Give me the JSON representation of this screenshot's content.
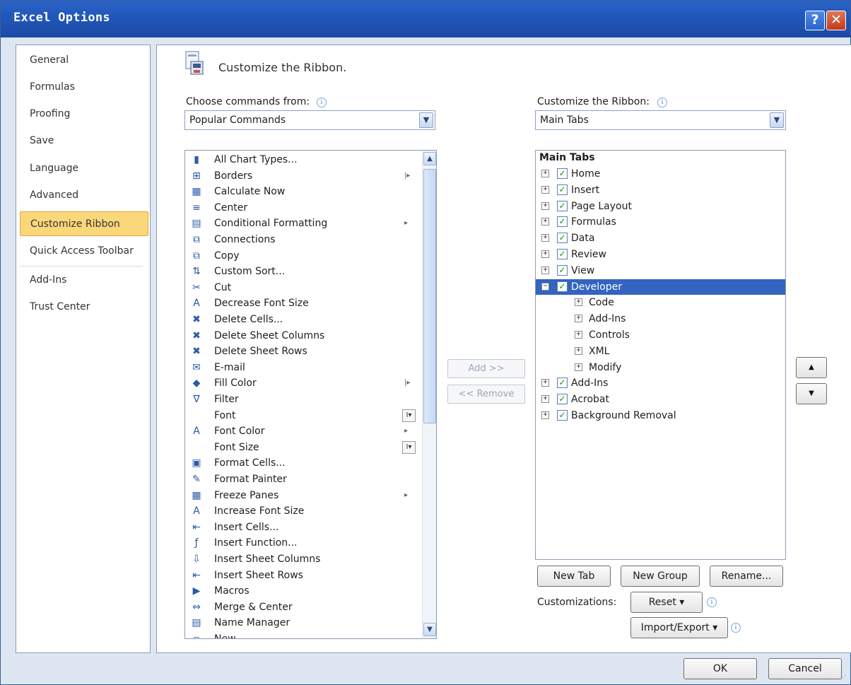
{
  "window": {
    "title": "Excel Options",
    "help": "?",
    "close": "✕"
  },
  "nav": {
    "items": [
      {
        "label": "General"
      },
      {
        "label": "Formulas"
      },
      {
        "label": "Proofing"
      },
      {
        "label": "Save"
      },
      {
        "label": "Language"
      },
      {
        "label": "Advanced"
      },
      {
        "label": "Customize Ribbon"
      },
      {
        "label": "Quick Access Toolbar"
      },
      {
        "label": "Add-Ins"
      },
      {
        "label": "Trust Center"
      }
    ],
    "selected": "Customize Ribbon"
  },
  "header": {
    "title": "Customize the Ribbon."
  },
  "left": {
    "label": "Choose commands from:",
    "combo_value": "Popular Commands",
    "commands": [
      {
        "label": "All Chart Types...",
        "icon": "chart-icon",
        "glyph": "▮"
      },
      {
        "label": "Borders",
        "icon": "borders-icon",
        "glyph": "⊞",
        "submenu": "|▸"
      },
      {
        "label": "Calculate Now",
        "icon": "calculator-icon",
        "glyph": "▦"
      },
      {
        "label": "Center",
        "icon": "align-center-icon",
        "glyph": "≡"
      },
      {
        "label": "Conditional Formatting",
        "icon": "conditional-formatting-icon",
        "glyph": "▤",
        "submenu": "▸"
      },
      {
        "label": "Connections",
        "icon": "connections-icon",
        "glyph": "⧉"
      },
      {
        "label": "Copy",
        "icon": "copy-icon",
        "glyph": "⧉"
      },
      {
        "label": "Custom Sort...",
        "icon": "sort-icon",
        "glyph": "⇅"
      },
      {
        "label": "Cut",
        "icon": "scissors-icon",
        "glyph": "✂"
      },
      {
        "label": "Decrease Font Size",
        "icon": "decrease-font-icon",
        "glyph": "A"
      },
      {
        "label": "Delete Cells...",
        "icon": "delete-cells-icon",
        "glyph": "✖"
      },
      {
        "label": "Delete Sheet Columns",
        "icon": "delete-columns-icon",
        "glyph": "✖"
      },
      {
        "label": "Delete Sheet Rows",
        "icon": "delete-rows-icon",
        "glyph": "✖"
      },
      {
        "label": "E-mail",
        "icon": "email-icon",
        "glyph": "✉"
      },
      {
        "label": "Fill Color",
        "icon": "fill-color-icon",
        "glyph": "◆",
        "submenu": "|▸"
      },
      {
        "label": "Filter",
        "icon": "filter-icon",
        "glyph": "∇"
      },
      {
        "label": "Font",
        "icon": "",
        "glyph": "",
        "spin": "I▾"
      },
      {
        "label": "Font Color",
        "icon": "font-color-icon",
        "glyph": "A",
        "submenu": "▸"
      },
      {
        "label": "Font Size",
        "icon": "",
        "glyph": "",
        "spin": "I▾"
      },
      {
        "label": "Format Cells...",
        "icon": "format-cells-icon",
        "glyph": "▣"
      },
      {
        "label": "Format Painter",
        "icon": "format-painter-icon",
        "glyph": "✎"
      },
      {
        "label": "Freeze Panes",
        "icon": "freeze-panes-icon",
        "glyph": "▦",
        "submenu": "▸"
      },
      {
        "label": "Increase Font Size",
        "icon": "increase-font-icon",
        "glyph": "A"
      },
      {
        "label": "Insert Cells...",
        "icon": "insert-cells-icon",
        "glyph": "⇤"
      },
      {
        "label": "Insert Function...",
        "icon": "function-icon",
        "glyph": "ƒ"
      },
      {
        "label": "Insert Sheet Columns",
        "icon": "insert-columns-icon",
        "glyph": "⇩"
      },
      {
        "label": "Insert Sheet Rows",
        "icon": "insert-rows-icon",
        "glyph": "⇤"
      },
      {
        "label": "Macros",
        "icon": "macros-icon",
        "glyph": "▶"
      },
      {
        "label": "Merge & Center",
        "icon": "merge-center-icon",
        "glyph": "⇔"
      },
      {
        "label": "Name Manager",
        "icon": "name-manager-icon",
        "glyph": "▤"
      },
      {
        "label": "New",
        "icon": "new-icon",
        "glyph": "▫"
      }
    ]
  },
  "middle": {
    "add": "Add >>",
    "remove": "<< Remove"
  },
  "right": {
    "label": "Customize the Ribbon:",
    "combo_value": "Main Tabs",
    "tree_header": "Main Tabs",
    "tree": [
      {
        "label": "Home",
        "level": 0,
        "expander": "+",
        "checked": true
      },
      {
        "label": "Insert",
        "level": 0,
        "expander": "+",
        "checked": true
      },
      {
        "label": "Page Layout",
        "level": 0,
        "expander": "+",
        "checked": true
      },
      {
        "label": "Formulas",
        "level": 0,
        "expander": "+",
        "checked": true
      },
      {
        "label": "Data",
        "level": 0,
        "expander": "+",
        "checked": true
      },
      {
        "label": "Review",
        "level": 0,
        "expander": "+",
        "checked": true
      },
      {
        "label": "View",
        "level": 0,
        "expander": "+",
        "checked": true
      },
      {
        "label": "Developer",
        "level": 0,
        "expander": "−",
        "checked": true,
        "selected": true
      },
      {
        "label": "Code",
        "level": 1,
        "expander": "+"
      },
      {
        "label": "Add-Ins",
        "level": 1,
        "expander": "+"
      },
      {
        "label": "Controls",
        "level": 1,
        "expander": "+"
      },
      {
        "label": "XML",
        "level": 1,
        "expander": "+"
      },
      {
        "label": "Modify",
        "level": 1,
        "expander": "+"
      },
      {
        "label": "Add-Ins",
        "level": 0,
        "expander": "+",
        "checked": true
      },
      {
        "label": "Acrobat",
        "level": 0,
        "expander": "+",
        "checked": true
      },
      {
        "label": "Background Removal",
        "level": 0,
        "expander": "+",
        "checked": true
      }
    ],
    "move_up": "▲",
    "move_down": "▼",
    "new_tab": "New Tab",
    "new_group": "New Group",
    "rename": "Rename...",
    "customizations_label": "Customizations:",
    "reset": "Reset ▾",
    "import_export": "Import/Export ▾"
  },
  "footer": {
    "ok": "OK",
    "cancel": "Cancel"
  },
  "colors": {
    "titlebar": "#2157b9",
    "selection": "#3264c0",
    "nav_selected": "#fbd77b"
  }
}
